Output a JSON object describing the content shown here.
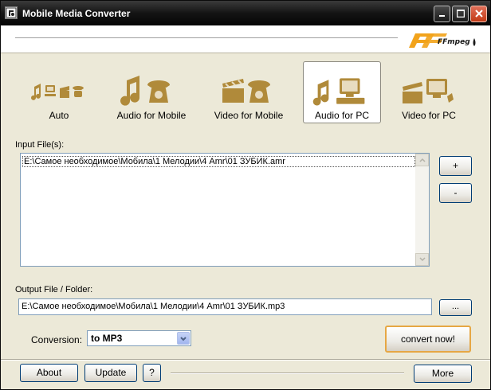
{
  "window": {
    "title": "Mobile Media Converter",
    "icons": {
      "app": "app-icon",
      "minimize": "minimize-icon",
      "maximize": "maximize-icon",
      "close": "close-icon"
    }
  },
  "header": {
    "logo_text": "FFmpeg"
  },
  "modes": [
    {
      "label": "Auto",
      "icon": "auto-mode-icon",
      "selected": false
    },
    {
      "label": "Audio for Mobile",
      "icon": "audio-for-mobile-icon",
      "selected": false
    },
    {
      "label": "Video for Mobile",
      "icon": "video-for-mobile-icon",
      "selected": false
    },
    {
      "label": "Audio for PC",
      "icon": "audio-for-pc-icon",
      "selected": true
    },
    {
      "label": "Video for PC",
      "icon": "video-for-pc-icon",
      "selected": false
    }
  ],
  "input": {
    "label": "Input File(s):",
    "files": [
      "E:\\Самое необходимое\\Мобила\\1 Мелодии\\4 Amr\\01 ЗУБИК.amr"
    ],
    "add_label": "+",
    "remove_label": "-"
  },
  "output": {
    "label": "Output File / Folder:",
    "value": "E:\\Самое необходимое\\Мобила\\1 Мелодии\\4 Amr\\01 ЗУБИК.mp3",
    "browse_label": "..."
  },
  "conversion": {
    "label": "Conversion:",
    "selected": "to MP3"
  },
  "convert_label": "convert now!",
  "footer": {
    "about_label": "About",
    "update_label": "Update",
    "help_label": "?",
    "more_label": "More"
  },
  "colors": {
    "accent_gold": "#b08a3a",
    "titlebar": "#141414",
    "focus_border": "#e6a744"
  }
}
